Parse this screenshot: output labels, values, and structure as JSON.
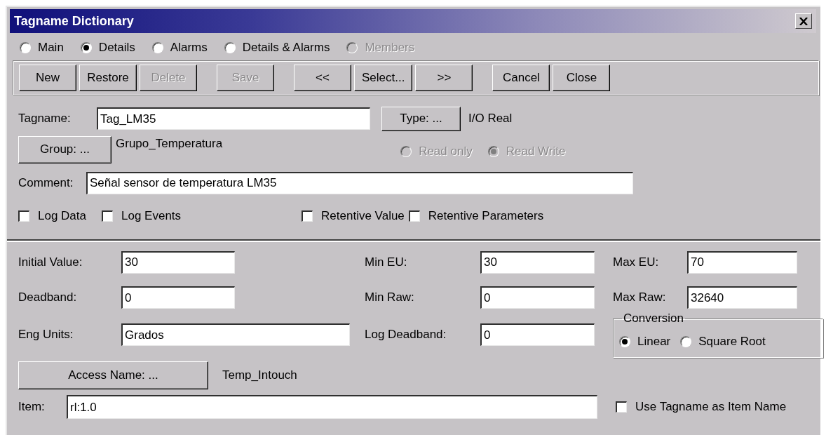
{
  "window": {
    "title": "Tagname Dictionary"
  },
  "view_options": [
    {
      "label": "Main",
      "selected": false,
      "disabled": false
    },
    {
      "label": "Details",
      "selected": true,
      "disabled": false
    },
    {
      "label": "Alarms",
      "selected": false,
      "disabled": false
    },
    {
      "label": "Details & Alarms",
      "selected": false,
      "disabled": false
    },
    {
      "label": "Members",
      "selected": false,
      "disabled": true
    }
  ],
  "toolbar": [
    [
      {
        "label": "New",
        "disabled": false
      },
      {
        "label": "Restore",
        "disabled": false
      },
      {
        "label": "Delete",
        "disabled": true
      }
    ],
    [
      {
        "label": "Save",
        "disabled": true
      }
    ],
    [
      {
        "label": "<<",
        "disabled": false
      },
      {
        "label": "Select...",
        "disabled": false
      },
      {
        "label": ">>",
        "disabled": false
      }
    ],
    [
      {
        "label": "Cancel",
        "disabled": false
      },
      {
        "label": "Close",
        "disabled": false
      }
    ]
  ],
  "tagname": {
    "label": "Tagname:",
    "value": "Tag_LM35"
  },
  "type": {
    "button": "Type: ...",
    "value": "I/O Real"
  },
  "group": {
    "button": "Group: ...",
    "value": "Grupo_Temperatura"
  },
  "access_options": [
    {
      "label": "Read only",
      "selected": false,
      "disabled": true
    },
    {
      "label": "Read Write",
      "selected": true,
      "disabled": true
    }
  ],
  "comment": {
    "label": "Comment:",
    "value": "Señal sensor de temperatura LM35"
  },
  "flags": [
    {
      "label": "Log Data",
      "checked": false
    },
    {
      "label": "Log Events",
      "checked": false
    },
    {
      "label": "Retentive Value",
      "checked": false
    },
    {
      "label": "Retentive Parameters",
      "checked": false
    }
  ],
  "fields": [
    {
      "kind": "initial",
      "label": "Initial Value:",
      "value": "30"
    },
    {
      "kind": "min_eu",
      "label": "Min EU:",
      "value": "30"
    },
    {
      "kind": "max_eu",
      "label": "Max EU:",
      "value": "70"
    },
    {
      "kind": "deadband",
      "label": "Deadband:",
      "value": "0"
    },
    {
      "kind": "min_raw",
      "label": "Min Raw:",
      "value": "0"
    },
    {
      "kind": "max_raw",
      "label": "Max Raw:",
      "value": "32640"
    },
    {
      "kind": "eng_units",
      "label": "Eng Units:",
      "value": "Grados"
    },
    {
      "kind": "log_deadband",
      "label": "Log Deadband:",
      "value": "0"
    }
  ],
  "conversion": {
    "title": "Conversion",
    "options": [
      {
        "label": "Linear",
        "selected": true
      },
      {
        "label": "Square Root",
        "selected": false
      }
    ]
  },
  "access_name": {
    "button": "Access Name: ...",
    "value": "Temp_Intouch"
  },
  "item": {
    "label": "Item:",
    "value": "rl:1.0"
  },
  "use_tagname": {
    "label": "Use Tagname as Item Name",
    "checked": false
  }
}
